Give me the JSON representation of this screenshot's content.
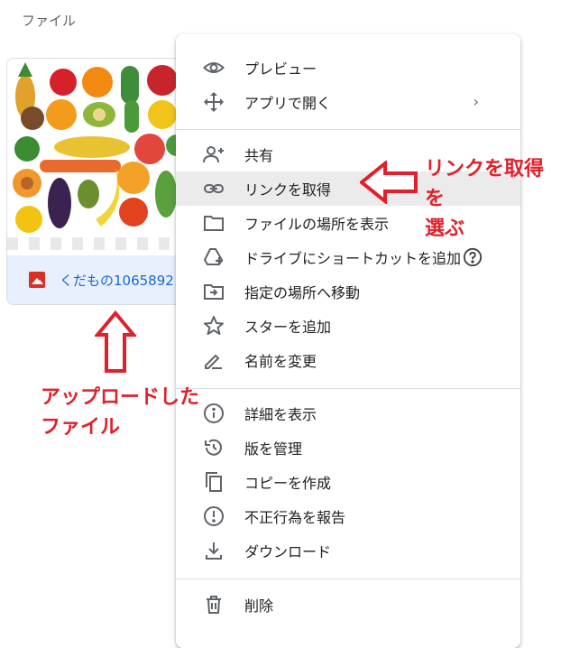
{
  "section_label": "ファイル",
  "file": {
    "name": "くだもの1065892",
    "icon": "image-icon",
    "icon_color": "#d93025"
  },
  "menu": {
    "groups": [
      [
        {
          "label": "プレビュー",
          "icon": "eye-icon"
        },
        {
          "label": "アプリで開く",
          "icon": "move-arrows-icon",
          "submenu": "›"
        }
      ],
      [
        {
          "label": "共有",
          "icon": "person-add-icon"
        },
        {
          "label": "リンクを取得",
          "icon": "link-icon",
          "highlighted": true
        },
        {
          "label": "ファイルの場所を表示",
          "icon": "folder-icon"
        },
        {
          "label": "ドライブにショートカットを追加",
          "icon": "drive-add-icon",
          "help": "question-circle-icon"
        },
        {
          "label": "指定の場所へ移動",
          "icon": "move-to-folder-icon"
        },
        {
          "label": "スターを追加",
          "icon": "star-icon"
        },
        {
          "label": "名前を変更",
          "icon": "pencil-icon"
        }
      ],
      [
        {
          "label": "詳細を表示",
          "icon": "info-icon"
        },
        {
          "label": "版を管理",
          "icon": "history-icon"
        },
        {
          "label": "コピーを作成",
          "icon": "copy-icon"
        },
        {
          "label": "不正行為を報告",
          "icon": "report-icon"
        },
        {
          "label": "ダウンロード",
          "icon": "download-icon"
        }
      ],
      [
        {
          "label": "削除",
          "icon": "trash-icon"
        }
      ]
    ]
  },
  "annotations": {
    "link_note": [
      "リンクを取得を",
      "選ぶ"
    ],
    "upload_note": [
      "アップロードした",
      "ファイル"
    ],
    "color": "#e0202a"
  },
  "colors": {
    "highlight": "#ebebeb",
    "file_footer": "#e8f0fe",
    "file_name": "#1967d2",
    "icon": "#5f6368"
  }
}
